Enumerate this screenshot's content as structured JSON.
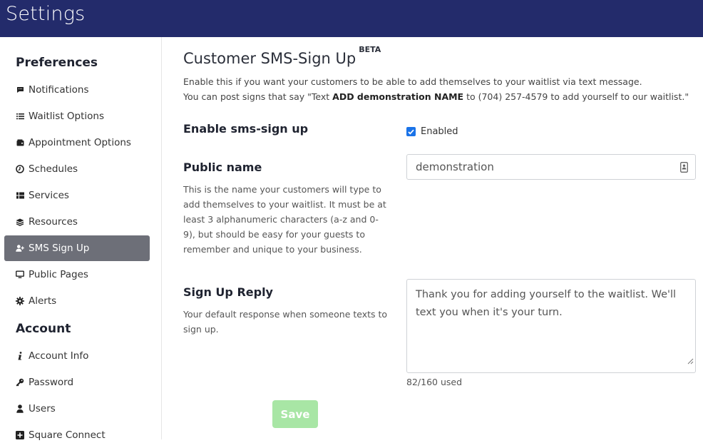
{
  "header": {
    "title": "Settings"
  },
  "sidebar": {
    "preferences_title": "Preferences",
    "account_title": "Account",
    "preferences_items": [
      {
        "label": "Notifications",
        "icon": "comment-icon"
      },
      {
        "label": "Waitlist Options",
        "icon": "list-icon"
      },
      {
        "label": "Appointment Options",
        "icon": "wallet-icon"
      },
      {
        "label": "Schedules",
        "icon": "clock-icon"
      },
      {
        "label": "Services",
        "icon": "grid-list-icon"
      },
      {
        "label": "Resources",
        "icon": "layers-icon"
      },
      {
        "label": "SMS Sign Up",
        "icon": "user-plus-icon",
        "active": true
      },
      {
        "label": "Public Pages",
        "icon": "monitor-icon"
      },
      {
        "label": "Alerts",
        "icon": "gear-icon"
      }
    ],
    "account_items": [
      {
        "label": "Account Info",
        "icon": "info-icon"
      },
      {
        "label": "Password",
        "icon": "key-icon"
      },
      {
        "label": "Users",
        "icon": "user-icon"
      },
      {
        "label": "Square Connect",
        "icon": "square-plus-icon"
      }
    ]
  },
  "main": {
    "title": "Customer SMS-Sign Up",
    "title_badge": "BETA",
    "desc_line1": "Enable this if you want your customers to be able to add themselves to your waitlist via text message.",
    "desc_line2_pre": "You can post signs that say \"Text ",
    "desc_line2_bold": "ADD demonstration NAME",
    "desc_line2_post": " to (704) 257-4579 to add yourself to our waitlist.\"",
    "enable_label": "Enable sms-sign up",
    "enabled_text": "Enabled",
    "enabled_checked": true,
    "public_name_label": "Public name",
    "public_name_help": "This is the name your customers will type to add themselves to your waitlist. It must be at least 3 alphanumeric characters (a-z and 0-9), but should be easy for your guests to remember and unique to your business.",
    "public_name_value": "demonstration",
    "reply_label": "Sign Up Reply",
    "reply_help": "Your default response when someone texts to sign up.",
    "reply_value": "Thank you for adding yourself to the waitlist. We'll text you when it's your turn.",
    "reply_counter": "82/160 used",
    "save_label": "Save"
  },
  "colors": {
    "header_bg": "#232b6b",
    "active_nav_bg": "#6d6f78",
    "save_button_bg": "#a8e6a5",
    "checkbox": "#1a73e8"
  }
}
